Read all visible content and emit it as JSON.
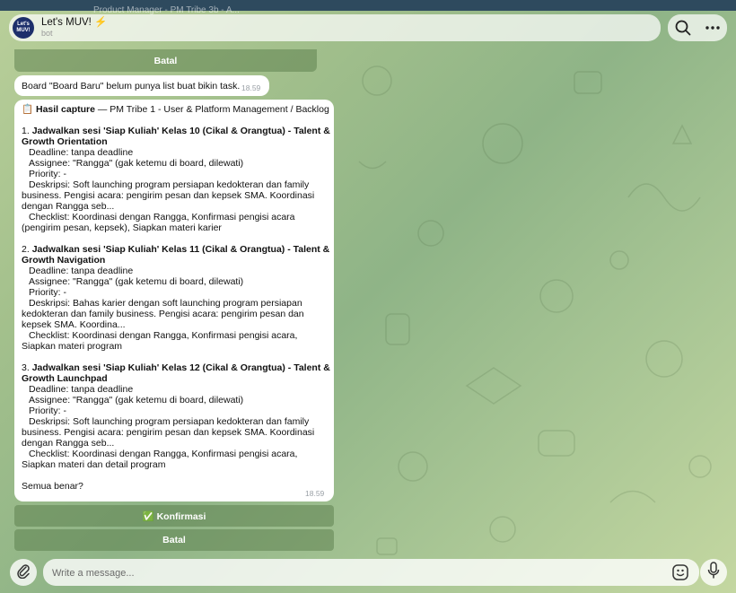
{
  "top_bar": {
    "ghost_text": "Product Manager - PM Tribe 3b - A..."
  },
  "header": {
    "avatar_text": "Let's MUV!",
    "title": "Let's MUV! ⚡",
    "subtitle": "bot",
    "search_icon": "search-icon",
    "menu_icon": "more-horizontal-icon"
  },
  "keyboard_top": {
    "label": "Batal"
  },
  "message1": {
    "text": "Board \"Board Baru\" belum punya list buat bikin task.",
    "time": "18.59"
  },
  "message2": {
    "title_bold": "Hasil capture",
    "title_rest": " — PM Tribe 1 - User & Platform Management / Backlog",
    "tasks": [
      {
        "num": "1. ",
        "title": "Jadwalkan sesi 'Siap Kuliah' Kelas 10 (Cikal & Orangtua) - Talent & Growth Orientation",
        "deadline": "Deadline: tanpa deadline",
        "assignee": "Assignee: \"Rangga\" (gak ketemu di board, dilewati)",
        "priority": "Priority: -",
        "description": "Deskripsi: Soft launching program persiapan kedokteran dan family business. Pengisi acara: pengirim pesan dan kepsek SMA. Koordinasi dengan Rangga seb...",
        "checklist": "Checklist: Koordinasi dengan Rangga, Konfirmasi pengisi acara (pengirim pesan, kepsek), Siapkan materi karier"
      },
      {
        "num": "2. ",
        "title": "Jadwalkan sesi 'Siap Kuliah' Kelas 11 (Cikal & Orangtua) - Talent & Growth Navigation",
        "deadline": "Deadline: tanpa deadline",
        "assignee": "Assignee: \"Rangga\" (gak ketemu di board, dilewati)",
        "priority": "Priority: -",
        "description": "Deskripsi: Bahas karier dengan soft launching program persiapan kedokteran dan family business. Pengisi acara: pengirim pesan dan kepsek SMA. Koordina...",
        "checklist": "Checklist: Koordinasi dengan Rangga, Konfirmasi pengisi acara, Siapkan materi program"
      },
      {
        "num": "3. ",
        "title": "Jadwalkan sesi 'Siap Kuliah' Kelas 12 (Cikal & Orangtua) - Talent & Growth Launchpad",
        "deadline": "Deadline: tanpa deadline",
        "assignee": "Assignee: \"Rangga\" (gak ketemu di board, dilewati)",
        "priority": "Priority: -",
        "description": "Deskripsi: Soft launching program persiapan kedokteran dan family business. Pengisi acara: pengirim pesan dan kepsek SMA. Koordinasi dengan Rangga seb...",
        "checklist": "Checklist: Koordinasi dengan Rangga, Konfirmasi pengisi acara, Siapkan materi dan detail program"
      }
    ],
    "footer": "Semua benar?",
    "time": "18.59"
  },
  "keyboard": {
    "confirm_label": "✅ Konfirmasi",
    "cancel_label": "Batal"
  },
  "composer": {
    "placeholder": "Write a message...",
    "attach_icon": "paperclip-icon",
    "sticker_icon": "sticker-icon",
    "mic_icon": "microphone-icon"
  },
  "colors": {
    "accent_button": "#567a48",
    "bubble_bg": "#ffffff",
    "avatar_bg": "#1d2f6b"
  }
}
